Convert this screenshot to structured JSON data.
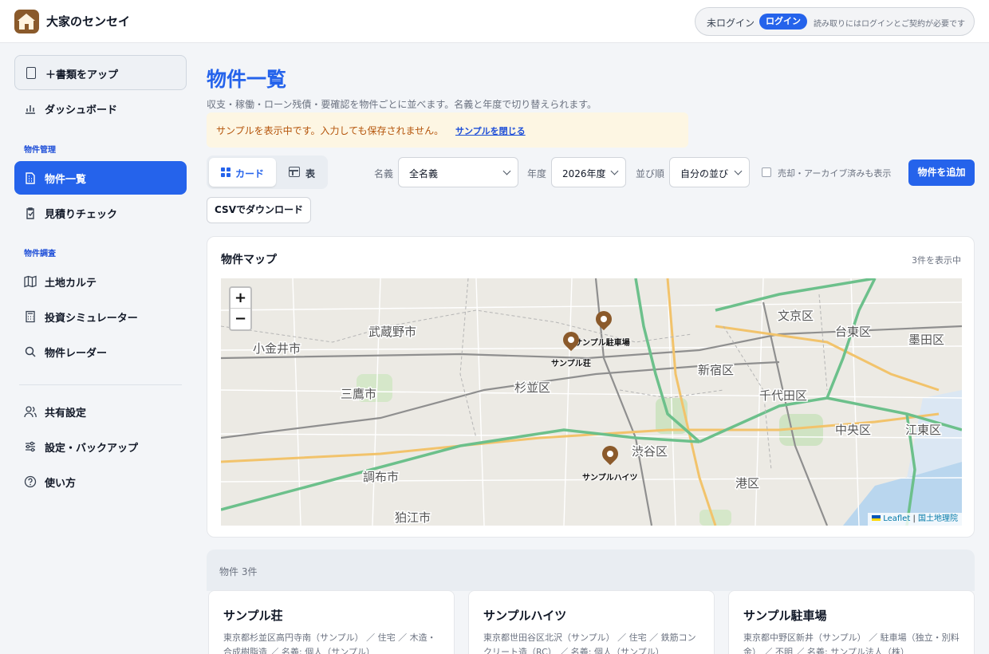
{
  "header": {
    "app_title": "大家のセンセイ",
    "auth_status": "未ログイン",
    "login_label": "ログイン",
    "auth_note": "読み取りにはログインとご契約が必要です"
  },
  "sidebar": {
    "upload_label": "＋書類をアップ",
    "dashboard_label": "ダッシュボード",
    "section_property_mgmt": "物件管理",
    "property_list_label": "物件一覧",
    "estimate_check_label": "見積りチェック",
    "section_property_research": "物件調査",
    "land_karte_label": "土地カルテ",
    "invest_sim_label": "投資シミュレーター",
    "property_radar_label": "物件レーダー",
    "sharing_label": "共有設定",
    "settings_label": "設定・バックアップ",
    "howto_label": "使い方"
  },
  "main": {
    "title": "物件一覧",
    "subtitle": "収支・稼働・ローン残債・要確認を物件ごとに並べます。名義と年度で切り替えられます。",
    "banner_text": "サンプルを表示中です。入力しても保存されません。",
    "banner_link": "サンプルを閉じる",
    "view_card_label": "カード",
    "view_table_label": "表",
    "owner_label": "名義",
    "owner_value": "全名義",
    "year_label": "年度",
    "year_value": "2026年度",
    "sort_label": "並び順",
    "sort_value": "自分の並び",
    "archive_label": "売却・アーカイブ済みも表示",
    "add_label": "物件を追加",
    "csv_label": "CSVでダウンロード"
  },
  "map": {
    "title": "物件マップ",
    "count": "3件を表示中",
    "zoom_in": "+",
    "zoom_out": "−",
    "attribution_leaflet": "Leaflet",
    "attribution_sep": "|",
    "attribution_gsi": "国土地理院",
    "markers": [
      {
        "label": "サンプル駐車場"
      },
      {
        "label": "サンプル荘"
      },
      {
        "label": "サンプルハイツ"
      }
    ],
    "place_labels": {
      "musashino": "武蔵野市",
      "koganei": "小金井市",
      "mitaka": "三鷹市",
      "suginami": "杉並区",
      "shinjuku": "新宿区",
      "chiyoda": "千代田区",
      "chofu": "調布市",
      "shibuya": "渋谷区",
      "minato": "港区",
      "bunkyo": "文京区",
      "chuo": "中央区",
      "koto": "江東区",
      "komae": "狛江市",
      "sumida": "墨田区",
      "taito": "台東区"
    }
  },
  "list": {
    "count_label": "物件 3件",
    "properties": [
      {
        "name": "サンプル荘",
        "meta": "東京都杉並区高円寺南（サンプル） ／ 住宅 ／ 木造・合成樹脂造 ／ 名義: 個人（サンプル）"
      },
      {
        "name": "サンプルハイツ",
        "meta": "東京都世田谷区北沢（サンプル） ／ 住宅 ／ 鉄筋コンクリート造（RC） ／ 名義: 個人（サンプル）"
      },
      {
        "name": "サンプル駐車場",
        "meta": "東京都中野区新井（サンプル） ／ 駐車場（独立・別料金） ／ 不明 ／ 名義: サンプル法人（株）"
      }
    ]
  },
  "colors": {
    "primary": "#2563eb",
    "marker": "#8b5a2b",
    "banner_bg": "#fdf6e3",
    "banner_text": "#b45309"
  }
}
